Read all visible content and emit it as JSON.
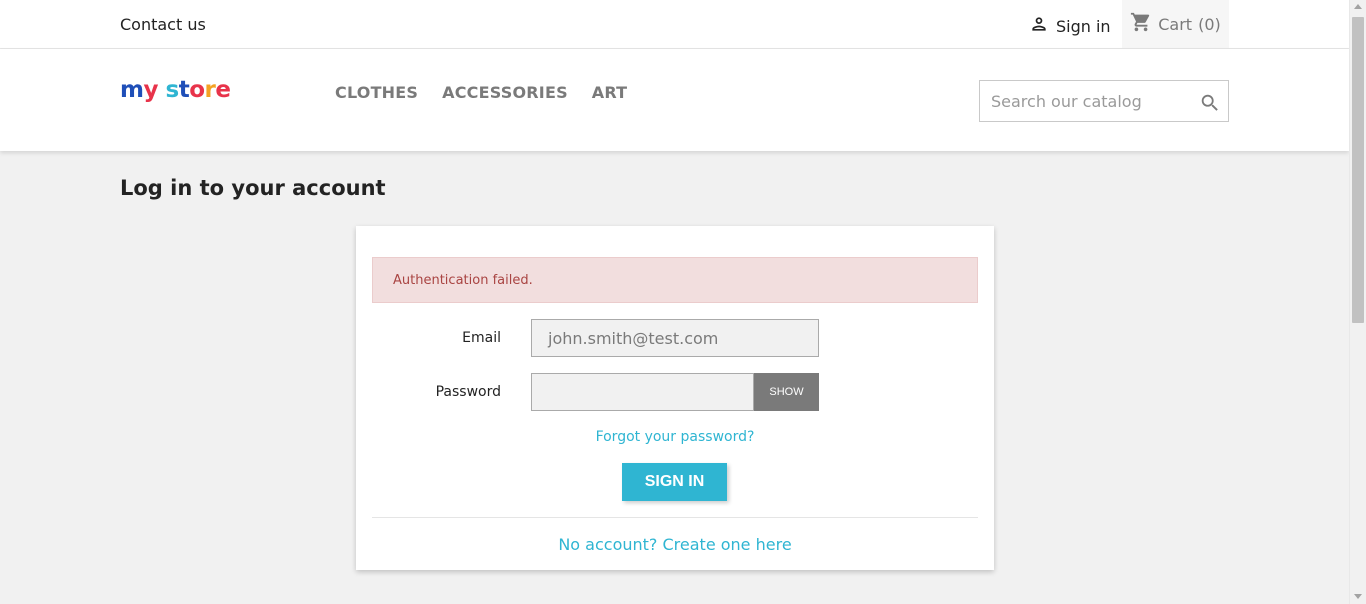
{
  "topbar": {
    "contact_label": "Contact us",
    "signin_label": "Sign in",
    "cart_label": "Cart",
    "cart_count": "(0)"
  },
  "header": {
    "logo_text": "my store",
    "nav_items": [
      "CLOTHES",
      "ACCESSORIES",
      "ART"
    ],
    "search_placeholder": "Search our catalog"
  },
  "main": {
    "page_title": "Log in to your account",
    "alert_text": "Authentication failed.",
    "email_label": "Email",
    "email_value": "john.smith@test.com",
    "password_label": "Password",
    "password_value": "",
    "show_label": "SHOW",
    "forgot_label": "Forgot your password?",
    "signin_button": "SIGN IN",
    "no_account_label": "No account? Create one here"
  },
  "colors": {
    "accent": "#2fb5d2",
    "alert_bg": "#f2dede",
    "alert_text": "#a94442",
    "nav_text": "#7a7a7a"
  },
  "icons": [
    "person-icon",
    "cart-icon",
    "search-icon"
  ]
}
